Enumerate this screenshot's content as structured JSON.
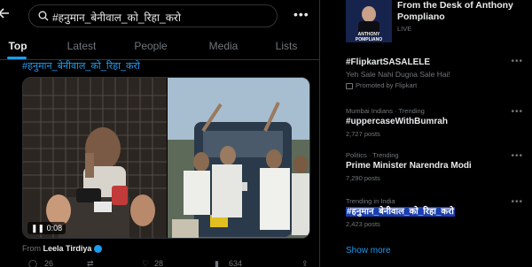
{
  "search": {
    "value": "#हनुमान_बेनीवाल_को_रिहा_करो",
    "placeholder": "Search"
  },
  "tabs": [
    {
      "label": "Top",
      "active": true
    },
    {
      "label": "Latest",
      "active": false
    },
    {
      "label": "People",
      "active": false
    },
    {
      "label": "Media",
      "active": false
    },
    {
      "label": "Lists",
      "active": false
    }
  ],
  "post": {
    "hashtag": "#हनुमान_बेनीवाल_को_रिहा_करो",
    "video_time": "0:08",
    "from_label": "From",
    "author": "Leela Tirdiya",
    "replies": "26",
    "likes": "28",
    "views": "634"
  },
  "sponsor": {
    "title": "From the Desk of Anthony Pompliano",
    "status": "LIVE",
    "image_text_1": "ANTHONY",
    "image_text_2": "POMPLIANO"
  },
  "trends": [
    {
      "meta": "",
      "title": "#FlipkartSASALELE",
      "sub": "Yeh Sale Nahi Dugna Sale Hai!",
      "promoted": "Promoted by Flipkart",
      "count": ""
    },
    {
      "meta": "Mumbai Indians · Trending",
      "title": "#uppercaseWithBumrah",
      "sub": "",
      "promoted": "",
      "count": "2,727 posts"
    },
    {
      "meta": "Politics · Trending",
      "title": "Prime Minister Narendra Modi",
      "sub": "",
      "promoted": "",
      "count": "7,290 posts"
    },
    {
      "meta": "Trending in India",
      "title": "#हनुमान_बेनीवाल_को_रिहा_करो",
      "sub": "",
      "promoted": "",
      "count": "2,423 posts"
    }
  ],
  "show_more": "Show more",
  "colors": {
    "accent": "#1d9bf0",
    "text": "#e7e9ea",
    "muted": "#71767b",
    "border": "#2f3336",
    "highlight": "#1a3fb0"
  },
  "icons": [
    "back-arrow-icon",
    "search-icon",
    "more-icon",
    "verified-icon",
    "reply-icon",
    "retweet-icon",
    "like-icon",
    "views-icon",
    "share-icon",
    "promoted-icon",
    "play-pause-icon"
  ]
}
